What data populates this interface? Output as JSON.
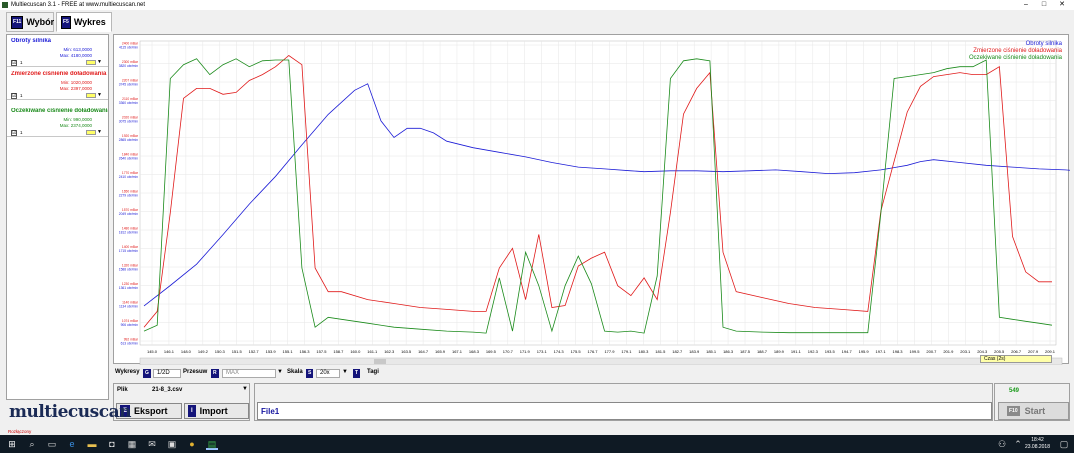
{
  "window": {
    "title": "Multiecuscan 3.1 - FREE at www.multiecuscan.net",
    "minimize": "–",
    "maximize": "□",
    "close": "✕"
  },
  "tabs": [
    {
      "key": "F11",
      "label": "Wybór"
    },
    {
      "key": "F5",
      "label": "Wykres"
    }
  ],
  "signals": [
    {
      "name": "Obroty silnika",
      "min": "Min: 613,0000",
      "max": "Max: 4180,0000",
      "color": "#1c1cd6",
      "checked": "☑",
      "index": "1",
      "dd": "▼"
    },
    {
      "name": "Zmierzone ciśnienie doładowania",
      "min": "Min: 1020,0000",
      "max": "Max: 2397,0000",
      "color": "#e01a1a",
      "checked": "☑",
      "index": "1",
      "dd": "▼"
    },
    {
      "name": "Oczekiwane ciśnienie doładowania",
      "min": "Min: 990,0000",
      "max": "Max: 2374,0000",
      "color": "#1a8a1a",
      "checked": "☑",
      "index": "1",
      "dd": "▼"
    }
  ],
  "legend": {
    "series1": "Obroty silnika",
    "series2": "Zmierzone ciśnienie doładowania",
    "series3": "Oczekiwane ciśnienie doładowania"
  },
  "chart_data": {
    "type": "line",
    "x_label": "Czas (2s)",
    "x_ticks": [
      "145.0",
      "146.1",
      "148.0",
      "149.2",
      "150.3",
      "151.5",
      "152.7",
      "153.9",
      "155.1",
      "156.3",
      "157.5",
      "158.7",
      "160.0",
      "161.1",
      "162.3",
      "163.5",
      "164.7",
      "165.9",
      "167.1",
      "168.3",
      "169.5",
      "170.7",
      "171.9",
      "173.1",
      "174.3",
      "175.5",
      "176.7",
      "177.9",
      "179.1",
      "180.3",
      "181.5",
      "182.7",
      "183.9",
      "185.1",
      "186.3",
      "187.5",
      "188.7",
      "189.9",
      "191.1",
      "192.3",
      "193.5",
      "194.7",
      "195.9",
      "197.1",
      "198.3",
      "199.5",
      "200.7",
      "201.9",
      "203.1",
      "204.3",
      "205.5",
      "206.7",
      "207.9",
      "209.1"
    ],
    "y_ticks_pressure": [
      "2400 mBar",
      "2300 mBar",
      "2207 mBar",
      "2110 mBar",
      "2020 mBar",
      "1920 mBar",
      "1840 mBar",
      "1770 mBar",
      "1650 mBar",
      "1570 mBar",
      "1480 mBar",
      "1400 mBar",
      "1320 mBar",
      "1230 mBar",
      "1140 mBar",
      "1074 mBar",
      "992 mBar"
    ],
    "y_ticks_rpm": [
      "4115 obr/min",
      "3820 obr/min",
      "3745 obr/min",
      "3360 obr/min",
      "3075 obr/min",
      "2865 obr/min",
      "2640 obr/min",
      "2410 obr/min",
      "2279 obr/min",
      "2049 obr/min",
      "1812 obr/min",
      "1715 obr/min",
      "1588 obr/min",
      "1361 obr/min",
      "1134 obr/min",
      "906 obr/min",
      "613 obr/min"
    ],
    "series": [
      {
        "name": "Obroty silnika",
        "color": "#1c1cd6",
        "values": [
          [
            0,
            1380
          ],
          [
            2,
            1600
          ],
          [
            4,
            1830
          ],
          [
            6,
            2150
          ],
          [
            8,
            2480
          ],
          [
            10,
            2780
          ],
          [
            12,
            3120
          ],
          [
            14,
            3450
          ],
          [
            16,
            3710
          ],
          [
            17,
            3780
          ],
          [
            18,
            3380
          ],
          [
            19,
            3200
          ],
          [
            20,
            3300
          ],
          [
            21,
            3300
          ],
          [
            22,
            3250
          ],
          [
            23,
            3160
          ],
          [
            25,
            3090
          ],
          [
            27,
            3040
          ],
          [
            29,
            2990
          ],
          [
            31,
            2930
          ],
          [
            33,
            2880
          ],
          [
            35,
            2860
          ],
          [
            37,
            2840
          ],
          [
            38,
            2830
          ],
          [
            40,
            2840
          ],
          [
            42,
            2840
          ],
          [
            44,
            2830
          ],
          [
            46,
            2840
          ],
          [
            48,
            2850
          ],
          [
            50,
            2830
          ],
          [
            52,
            2810
          ],
          [
            54,
            2820
          ],
          [
            56,
            2850
          ],
          [
            58,
            2900
          ],
          [
            59,
            2940
          ],
          [
            60,
            2960
          ],
          [
            62,
            2930
          ],
          [
            64,
            2900
          ],
          [
            66,
            2880
          ],
          [
            68,
            2860
          ],
          [
            70,
            2850
          ],
          [
            72,
            2830
          ],
          [
            73,
            2820
          ],
          [
            74,
            2830
          ],
          [
            76,
            2900
          ],
          [
            78,
            3000
          ],
          [
            80,
            3100
          ],
          [
            82,
            3180
          ],
          [
            83,
            3210
          ],
          [
            84,
            3180
          ],
          [
            85,
            3160
          ],
          [
            86,
            3150
          ],
          [
            87,
            3120
          ]
        ]
      },
      {
        "name": "Zmierzone ciśnienie doładowania",
        "color": "#e01a1a",
        "values": [
          [
            0,
            1020
          ],
          [
            1,
            1100
          ],
          [
            2,
            1600
          ],
          [
            3,
            2180
          ],
          [
            4,
            2230
          ],
          [
            5,
            2230
          ],
          [
            6,
            2200
          ],
          [
            7,
            2210
          ],
          [
            8,
            2270
          ],
          [
            9,
            2300
          ],
          [
            10,
            2340
          ],
          [
            11,
            2397
          ],
          [
            12,
            2350
          ],
          [
            13,
            1320
          ],
          [
            14,
            1200
          ],
          [
            15,
            1200
          ],
          [
            17,
            1160
          ],
          [
            19,
            1140
          ],
          [
            21,
            1120
          ],
          [
            23,
            1110
          ],
          [
            25,
            1100
          ],
          [
            26,
            1100
          ],
          [
            27,
            1320
          ],
          [
            28,
            1420
          ],
          [
            29,
            1160
          ],
          [
            30,
            1490
          ],
          [
            31,
            1120
          ],
          [
            32,
            1130
          ],
          [
            33,
            1330
          ],
          [
            34,
            1370
          ],
          [
            35,
            1400
          ],
          [
            36,
            1230
          ],
          [
            37,
            1180
          ],
          [
            38,
            1270
          ],
          [
            39,
            1160
          ],
          [
            40,
            1600
          ],
          [
            41,
            2100
          ],
          [
            42,
            2230
          ],
          [
            43,
            2310
          ],
          [
            44,
            1400
          ],
          [
            45,
            1200
          ],
          [
            47,
            1170
          ],
          [
            49,
            1140
          ],
          [
            51,
            1120
          ],
          [
            53,
            1110
          ],
          [
            55,
            1100
          ],
          [
            56,
            1610
          ],
          [
            57,
            1860
          ],
          [
            58,
            2110
          ],
          [
            59,
            2240
          ],
          [
            60,
            2290
          ],
          [
            61,
            2300
          ],
          [
            62,
            2310
          ],
          [
            63,
            2300
          ],
          [
            64,
            2300
          ],
          [
            65,
            2340
          ],
          [
            66,
            1480
          ],
          [
            67,
            1300
          ],
          [
            68,
            1250
          ],
          [
            69,
            1250
          ]
        ]
      },
      {
        "name": "Oczekiwane ciśnienie doładowania",
        "color": "#1a8a1a",
        "values": [
          [
            0,
            1000
          ],
          [
            1,
            1030
          ],
          [
            2,
            2280
          ],
          [
            3,
            2350
          ],
          [
            4,
            2380
          ],
          [
            5,
            2300
          ],
          [
            6,
            2350
          ],
          [
            7,
            2380
          ],
          [
            8,
            2340
          ],
          [
            9,
            2370
          ],
          [
            10,
            2374
          ],
          [
            11,
            2374
          ],
          [
            12,
            1320
          ],
          [
            13,
            1020
          ],
          [
            14,
            1070
          ],
          [
            15,
            1060
          ],
          [
            17,
            1040
          ],
          [
            19,
            1020
          ],
          [
            21,
            1010
          ],
          [
            23,
            1000
          ],
          [
            25,
            995
          ],
          [
            26,
            990
          ],
          [
            27,
            1270
          ],
          [
            28,
            1000
          ],
          [
            29,
            1400
          ],
          [
            30,
            1230
          ],
          [
            31,
            1000
          ],
          [
            32,
            1230
          ],
          [
            33,
            1380
          ],
          [
            34,
            1240
          ],
          [
            35,
            1000
          ],
          [
            36,
            995
          ],
          [
            37,
            1000
          ],
          [
            38,
            990
          ],
          [
            39,
            1280
          ],
          [
            40,
            2280
          ],
          [
            41,
            2370
          ],
          [
            42,
            2380
          ],
          [
            43,
            2370
          ],
          [
            44,
            1020
          ],
          [
            45,
            1000
          ],
          [
            47,
            995
          ],
          [
            49,
            992
          ],
          [
            51,
            992
          ],
          [
            53,
            992
          ],
          [
            55,
            992
          ],
          [
            56,
            1600
          ],
          [
            57,
            2280
          ],
          [
            58,
            2290
          ],
          [
            59,
            2300
          ],
          [
            60,
            2310
          ],
          [
            61,
            2330
          ],
          [
            62,
            2340
          ],
          [
            63,
            2340
          ],
          [
            64,
            2374
          ],
          [
            65,
            1070
          ],
          [
            66,
            1060
          ],
          [
            67,
            1050
          ],
          [
            68,
            1040
          ],
          [
            69,
            1030
          ]
        ]
      }
    ]
  },
  "controls": {
    "wykresy_label": "Wykresy",
    "wykresy_key": "G",
    "wykresy_value": "1/2D",
    "przesuw_label": "Przesuw",
    "przesuw_key": "R",
    "przesuw_value": "MAX",
    "skala_label": "Skala",
    "skala_key": "S",
    "skala_value": "20x",
    "tagi_key": "T",
    "tagi_label": "Tagi",
    "dd": "▼"
  },
  "file": {
    "plik_label": "Plik",
    "plik_value": "21-8_3.csv",
    "eksport_key": "E",
    "eksport_label": "Eksport",
    "import_key": "I",
    "import_label": "Import",
    "name_field": "File1"
  },
  "right": {
    "counter": "549",
    "start_key": "F10",
    "start_label": "Start"
  },
  "logo": "multiecuscan",
  "status": "Rozłączony",
  "taskbar": {
    "time": "18:42",
    "date": "23.08.2018"
  }
}
